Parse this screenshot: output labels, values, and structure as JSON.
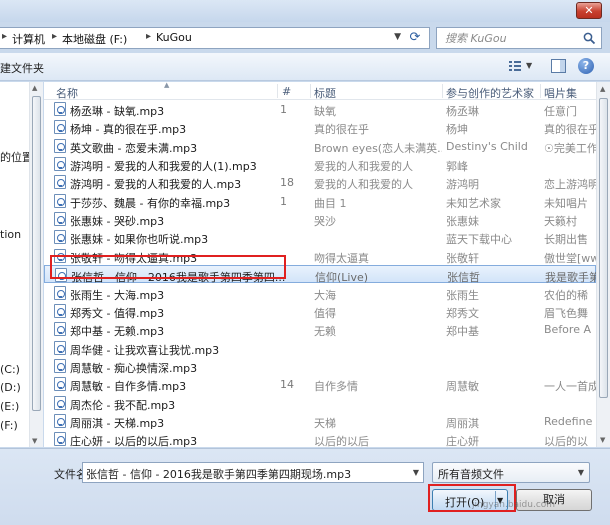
{
  "addressbar": {
    "crumbs": [
      "计算机",
      "本地磁盘 (F:)",
      "KuGou"
    ]
  },
  "search": {
    "placeholder": "搜索 KuGou"
  },
  "toolbar": {
    "new_folder": "建文件夹"
  },
  "nav": {
    "items": [
      "的位置",
      "tion",
      "(C:)",
      "(D:)",
      "(E:)",
      "(F:)"
    ]
  },
  "columns": {
    "name": "名称",
    "number": "#",
    "title": "标题",
    "artist": "参与创作的艺术家",
    "album": "唱片集"
  },
  "files": [
    {
      "name": "杨丞琳 - 缺氧.mp3",
      "num": "1",
      "title": "缺氧",
      "artist": "杨丞琳",
      "album": "任意门"
    },
    {
      "name": "杨坤 - 真的很在乎.mp3",
      "num": "",
      "title": "真的很在乎",
      "artist": "杨坤",
      "album": "真的很在乎"
    },
    {
      "name": "英文歌曲 - 恋爱未满.mp3",
      "num": "",
      "title": "Brown eyes(恋人未满英...",
      "artist": "Destiny's Child",
      "album": "☉完美工作"
    },
    {
      "name": "游鸿明 - 爱我的人和我爱的人(1).mp3",
      "num": "",
      "title": "爱我的人和我爱的人",
      "artist": "郭峰",
      "album": ""
    },
    {
      "name": "游鸿明 - 爱我的人和我爱的人.mp3",
      "num": "18",
      "title": "爱我的人和我爱的人",
      "artist": "游鸿明",
      "album": "恋上游鸿明"
    },
    {
      "name": "于莎莎、魏晨 - 有你的幸福.mp3",
      "num": "1",
      "title": "曲目 1",
      "artist": "未知艺术家",
      "album": "未知唱片"
    },
    {
      "name": "张惠妹 - 哭砂.mp3",
      "num": "",
      "title": "哭沙",
      "artist": "张惠妹",
      "album": "天籁村"
    },
    {
      "name": "张惠妹 - 如果你也听说.mp3",
      "num": "",
      "title": "",
      "artist": "蓝天下载中心",
      "album": "长期出售"
    },
    {
      "name": "张敬轩 - 吻得太逼真.mp3",
      "num": "",
      "title": "吻得太逼真",
      "artist": "张敬轩",
      "album": "傲世堂[ww"
    },
    {
      "name": "张信哲 - 信仰 - 2016我是歌手第四季第四...",
      "num": "",
      "title": "信仰(Live)",
      "artist": "张信哲",
      "album": "我是歌手第",
      "selected": true
    },
    {
      "name": "张雨生 - 大海.mp3",
      "num": "",
      "title": "大海",
      "artist": "张雨生",
      "album": "农伯的稀"
    },
    {
      "name": "郑秀文 - 值得.mp3",
      "num": "",
      "title": "值得",
      "artist": "郑秀文",
      "album": "眉飞色舞"
    },
    {
      "name": "郑中基 - 无赖.mp3",
      "num": "",
      "title": "无赖",
      "artist": "郑中基",
      "album": "Before A"
    },
    {
      "name": "周华健 - 让我欢喜让我忧.mp3",
      "num": "",
      "title": "",
      "artist": "",
      "album": ""
    },
    {
      "name": "周慧敏 - 痴心换情深.mp3",
      "num": "",
      "title": "",
      "artist": "",
      "album": ""
    },
    {
      "name": "周慧敏 - 自作多情.mp3",
      "num": "14",
      "title": "自作多情",
      "artist": "周慧敏",
      "album": "一人一首成"
    },
    {
      "name": "周杰伦 - 我不配.mp3",
      "num": "",
      "title": "",
      "artist": "",
      "album": ""
    },
    {
      "name": "周丽淇 - 天梯.mp3",
      "num": "",
      "title": "天梯",
      "artist": "周丽淇",
      "album": "Redefine"
    },
    {
      "name": "庄心妍 - 以后的以后.mp3",
      "num": "",
      "title": "以后的以后",
      "artist": "庄心妍",
      "album": "以后的以"
    }
  ],
  "filename": {
    "label": "文件名(N):",
    "value": "张信哲 - 信仰 - 2016我是歌手第四季第四期现场.mp3"
  },
  "filetype": {
    "value": "所有音频文件"
  },
  "buttons": {
    "open": "打开(O)",
    "cancel": "取消"
  },
  "watermark": "jingyan.baidu.com"
}
